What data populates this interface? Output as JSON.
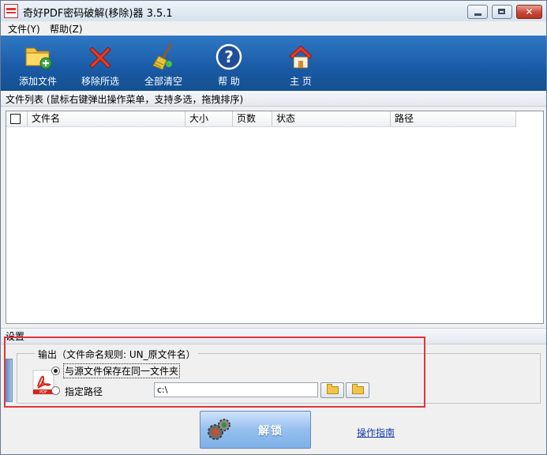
{
  "window": {
    "title": "奇好PDF密码破解(移除)器 3.5.1",
    "close_glyph": "✕"
  },
  "menu": {
    "file": "文件(Y)",
    "help": "帮助(Z)"
  },
  "toolbar": {
    "add_file": "添加文件",
    "remove_selected": "移除所选",
    "clear_all": "全部清空",
    "help": "帮 助",
    "home": "主 页"
  },
  "hint": {
    "text": "文件列表   (鼠标右键弹出操作菜单，支持多选，拖拽排序)"
  },
  "file_list": {
    "columns": [
      "文件名",
      "大小",
      "页数",
      "状态",
      "路径"
    ],
    "rows": []
  },
  "settings": {
    "header": "设置",
    "output_legend": "输出（文件命名规则: UN_原文件名）",
    "option_same_folder": "与源文件保存在同一文件夹",
    "option_custom_path": "指定路径",
    "custom_path_value": "c:\\",
    "selected_option": "same_folder"
  },
  "actions": {
    "unlock": "解锁",
    "guide_link": "操作指南"
  },
  "colors": {
    "toolbar_blue": "#1a5aa6",
    "highlight_red": "#e0353b",
    "link_blue": "#1a3dab"
  },
  "icons": {
    "add_file": "folder-add-icon",
    "remove_selected": "red-x-icon",
    "clear_all": "broom-icon",
    "help": "question-icon",
    "home": "house-icon",
    "pdf": "pdf-file-icon",
    "unlock": "gears-icon"
  }
}
